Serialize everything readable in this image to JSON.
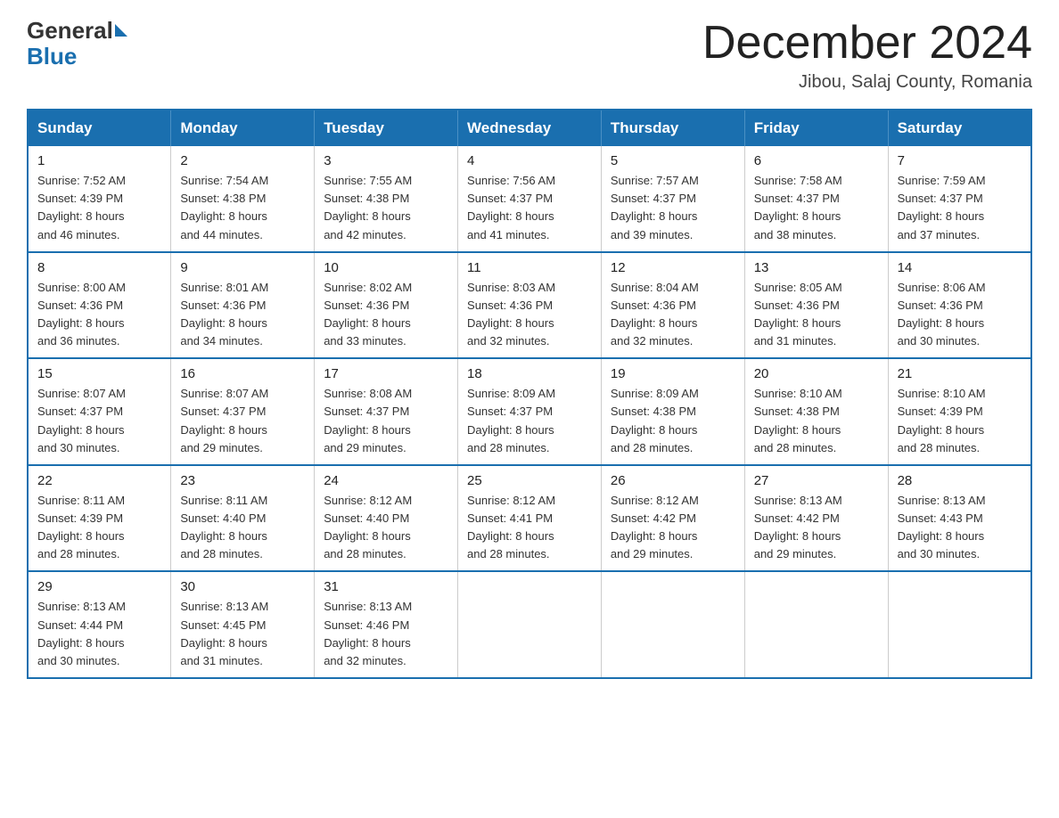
{
  "header": {
    "logo_text_general": "General",
    "logo_text_blue": "Blue",
    "month_title": "December 2024",
    "location": "Jibou, Salaj County, Romania"
  },
  "weekdays": [
    "Sunday",
    "Monday",
    "Tuesday",
    "Wednesday",
    "Thursday",
    "Friday",
    "Saturday"
  ],
  "weeks": [
    [
      {
        "day": "1",
        "info": "Sunrise: 7:52 AM\nSunset: 4:39 PM\nDaylight: 8 hours\nand 46 minutes."
      },
      {
        "day": "2",
        "info": "Sunrise: 7:54 AM\nSunset: 4:38 PM\nDaylight: 8 hours\nand 44 minutes."
      },
      {
        "day": "3",
        "info": "Sunrise: 7:55 AM\nSunset: 4:38 PM\nDaylight: 8 hours\nand 42 minutes."
      },
      {
        "day": "4",
        "info": "Sunrise: 7:56 AM\nSunset: 4:37 PM\nDaylight: 8 hours\nand 41 minutes."
      },
      {
        "day": "5",
        "info": "Sunrise: 7:57 AM\nSunset: 4:37 PM\nDaylight: 8 hours\nand 39 minutes."
      },
      {
        "day": "6",
        "info": "Sunrise: 7:58 AM\nSunset: 4:37 PM\nDaylight: 8 hours\nand 38 minutes."
      },
      {
        "day": "7",
        "info": "Sunrise: 7:59 AM\nSunset: 4:37 PM\nDaylight: 8 hours\nand 37 minutes."
      }
    ],
    [
      {
        "day": "8",
        "info": "Sunrise: 8:00 AM\nSunset: 4:36 PM\nDaylight: 8 hours\nand 36 minutes."
      },
      {
        "day": "9",
        "info": "Sunrise: 8:01 AM\nSunset: 4:36 PM\nDaylight: 8 hours\nand 34 minutes."
      },
      {
        "day": "10",
        "info": "Sunrise: 8:02 AM\nSunset: 4:36 PM\nDaylight: 8 hours\nand 33 minutes."
      },
      {
        "day": "11",
        "info": "Sunrise: 8:03 AM\nSunset: 4:36 PM\nDaylight: 8 hours\nand 32 minutes."
      },
      {
        "day": "12",
        "info": "Sunrise: 8:04 AM\nSunset: 4:36 PM\nDaylight: 8 hours\nand 32 minutes."
      },
      {
        "day": "13",
        "info": "Sunrise: 8:05 AM\nSunset: 4:36 PM\nDaylight: 8 hours\nand 31 minutes."
      },
      {
        "day": "14",
        "info": "Sunrise: 8:06 AM\nSunset: 4:36 PM\nDaylight: 8 hours\nand 30 minutes."
      }
    ],
    [
      {
        "day": "15",
        "info": "Sunrise: 8:07 AM\nSunset: 4:37 PM\nDaylight: 8 hours\nand 30 minutes."
      },
      {
        "day": "16",
        "info": "Sunrise: 8:07 AM\nSunset: 4:37 PM\nDaylight: 8 hours\nand 29 minutes."
      },
      {
        "day": "17",
        "info": "Sunrise: 8:08 AM\nSunset: 4:37 PM\nDaylight: 8 hours\nand 29 minutes."
      },
      {
        "day": "18",
        "info": "Sunrise: 8:09 AM\nSunset: 4:37 PM\nDaylight: 8 hours\nand 28 minutes."
      },
      {
        "day": "19",
        "info": "Sunrise: 8:09 AM\nSunset: 4:38 PM\nDaylight: 8 hours\nand 28 minutes."
      },
      {
        "day": "20",
        "info": "Sunrise: 8:10 AM\nSunset: 4:38 PM\nDaylight: 8 hours\nand 28 minutes."
      },
      {
        "day": "21",
        "info": "Sunrise: 8:10 AM\nSunset: 4:39 PM\nDaylight: 8 hours\nand 28 minutes."
      }
    ],
    [
      {
        "day": "22",
        "info": "Sunrise: 8:11 AM\nSunset: 4:39 PM\nDaylight: 8 hours\nand 28 minutes."
      },
      {
        "day": "23",
        "info": "Sunrise: 8:11 AM\nSunset: 4:40 PM\nDaylight: 8 hours\nand 28 minutes."
      },
      {
        "day": "24",
        "info": "Sunrise: 8:12 AM\nSunset: 4:40 PM\nDaylight: 8 hours\nand 28 minutes."
      },
      {
        "day": "25",
        "info": "Sunrise: 8:12 AM\nSunset: 4:41 PM\nDaylight: 8 hours\nand 28 minutes."
      },
      {
        "day": "26",
        "info": "Sunrise: 8:12 AM\nSunset: 4:42 PM\nDaylight: 8 hours\nand 29 minutes."
      },
      {
        "day": "27",
        "info": "Sunrise: 8:13 AM\nSunset: 4:42 PM\nDaylight: 8 hours\nand 29 minutes."
      },
      {
        "day": "28",
        "info": "Sunrise: 8:13 AM\nSunset: 4:43 PM\nDaylight: 8 hours\nand 30 minutes."
      }
    ],
    [
      {
        "day": "29",
        "info": "Sunrise: 8:13 AM\nSunset: 4:44 PM\nDaylight: 8 hours\nand 30 minutes."
      },
      {
        "day": "30",
        "info": "Sunrise: 8:13 AM\nSunset: 4:45 PM\nDaylight: 8 hours\nand 31 minutes."
      },
      {
        "day": "31",
        "info": "Sunrise: 8:13 AM\nSunset: 4:46 PM\nDaylight: 8 hours\nand 32 minutes."
      },
      {
        "day": "",
        "info": ""
      },
      {
        "day": "",
        "info": ""
      },
      {
        "day": "",
        "info": ""
      },
      {
        "day": "",
        "info": ""
      }
    ]
  ]
}
